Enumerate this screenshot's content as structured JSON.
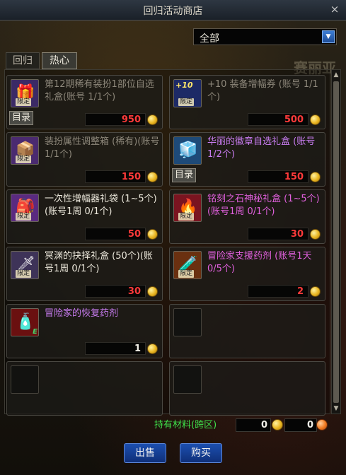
{
  "window": {
    "title": "回归活动商店",
    "close_glyph": "×"
  },
  "filter": {
    "selected": "全部",
    "arrow_glyph": "▼"
  },
  "tabs": [
    {
      "label": "回归",
      "active": false
    },
    {
      "label": "热心",
      "active": true
    }
  ],
  "background_text": {
    "top_right": "赛丽亚"
  },
  "items": [
    {
      "name": "第12期稀有装扮1部位自选礼盒(账号 1/1个)",
      "price": "950",
      "price_color": "red",
      "name_style": "gray",
      "limited": "限定",
      "catalog": "目录",
      "icon": "purple-gift-box-icon",
      "icon_bg": "#3b2a66"
    },
    {
      "name": "+10 装备增幅券 (账号 1/1个)",
      "price": "500",
      "price_color": "red",
      "name_style": "gray",
      "limited": "限定",
      "plus": "+10",
      "icon": "amplify-ticket-icon",
      "icon_bg": "#1d2a66"
    },
    {
      "name": "装扮属性调整箱 (稀有)(账号 1/1个)",
      "price": "150",
      "price_color": "red",
      "name_style": "gray",
      "limited": "限定",
      "icon": "purple-box-icon",
      "icon_bg": "#4a2a70"
    },
    {
      "name": "华丽的徽章自选礼盒 (账号 1/2个)",
      "price": "150",
      "price_color": "red",
      "name_style": "purple",
      "catalog": "目录",
      "icon": "ice-gift-box-icon",
      "icon_bg": "#1e4a78"
    },
    {
      "name": "一次性增幅器礼袋 (1~5个)(账号1周 0/1个)",
      "price": "50",
      "price_color": "red",
      "name_style": "white",
      "limited": "限定",
      "icon": "amplifier-bag-icon",
      "icon_bg": "#5a2a80"
    },
    {
      "name": "铭刻之石神秘礼盒 (1~5个)(账号1周 0/1个)",
      "price": "30",
      "price_color": "red",
      "name_style": "pink",
      "limited": "限定",
      "icon": "inscription-stone-icon",
      "icon_bg": "#7a1420"
    },
    {
      "name": "冥渊的抉择礼盒 (50个)(账号1周 0/1个)",
      "price": "30",
      "price_color": "red",
      "name_style": "white",
      "limited": "限定",
      "icon": "abyss-box-icon",
      "icon_bg": "#3e3358"
    },
    {
      "name": "冒险家支援药剂 (账号1天 0/5个)",
      "price": "2",
      "price_color": "red",
      "name_style": "pink",
      "limited": "限定",
      "icon": "support-potion-icon",
      "icon_bg": "#6a3010"
    },
    {
      "name": "冒险家的恢复药剂",
      "price": "1",
      "price_color": "white",
      "name_style": "purple",
      "ebadge": "E",
      "icon": "recovery-potion-icon",
      "icon_bg": "#6a1010"
    }
  ],
  "materials": {
    "label": "持有材料(跨区)",
    "gold_amount": "0",
    "orange_amount": "0"
  },
  "buttons": {
    "sell": "出售",
    "buy": "购买"
  },
  "scroll": {
    "up_glyph": "▲",
    "down_glyph": "▼"
  }
}
